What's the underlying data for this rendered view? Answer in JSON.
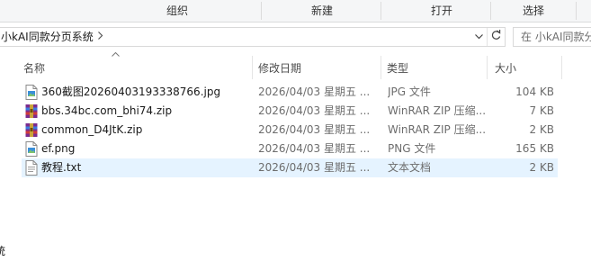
{
  "ribbon": {
    "groups": [
      "组织",
      "新建",
      "打开",
      "选择"
    ]
  },
  "address": {
    "path": "小kAI同款分页系统",
    "chevron_icon": "chevron-right-icon",
    "dropdown_icon": "chevron-down-icon",
    "refresh_icon": "refresh-icon"
  },
  "search": {
    "placeholder": "在 小kAI同款分页"
  },
  "nav": {
    "partial_text": "统"
  },
  "columns": {
    "name": "名称",
    "date": "修改日期",
    "type": "类型",
    "size": "大小",
    "sort_icon": "sort-ascending-icon"
  },
  "files": [
    {
      "name": "360截图20260403193338766.jpg",
      "date": "2026/04/03 星期五 ...",
      "type": "JPG 文件",
      "size": "104 KB",
      "icon": "image-file-icon",
      "selected": false
    },
    {
      "name": "bbs.34bc.com_bhi74.zip",
      "date": "2026/04/03 星期五 ...",
      "type": "WinRAR ZIP 压缩...",
      "size": "7 KB",
      "icon": "winrar-archive-icon",
      "selected": false
    },
    {
      "name": "common_D4JtK.zip",
      "date": "2026/04/03 星期五 ...",
      "type": "WinRAR ZIP 压缩...",
      "size": "2 KB",
      "icon": "winrar-archive-icon",
      "selected": false
    },
    {
      "name": "ef.png",
      "date": "2026/04/03 星期五 ...",
      "type": "PNG 文件",
      "size": "165 KB",
      "icon": "image-file-icon",
      "selected": false
    },
    {
      "name": "教程.txt",
      "date": "2026/04/03 星期五 ...",
      "type": "文本文档",
      "size": "2 KB",
      "icon": "text-file-icon",
      "selected": true
    }
  ],
  "colors": {
    "selection": "#e5f3ff",
    "ribbon_bg": "#f5f6f7",
    "secondary_text": "#6d6d6d"
  }
}
